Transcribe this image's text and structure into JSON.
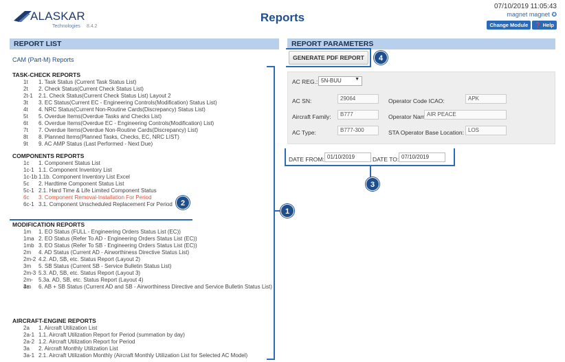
{
  "header": {
    "brand": "ALASKAR",
    "brand_sub": "Technologies",
    "version": "8.4.2",
    "title": "Reports",
    "datetime": "07/10/2019 11:05:43",
    "user": "magnet magnet",
    "change_module_label": "Change Module",
    "help_label": "Help"
  },
  "left": {
    "panel_title": "REPORT LIST",
    "cam_link": "CAM (Part-M) Reports",
    "sections": [
      {
        "title": "TASK-CHECK REPORTS",
        "items": [
          {
            "code": "1t",
            "label": "1. Task Status (Current Task Status List)"
          },
          {
            "code": "2t",
            "label": "2. Check Status(Current Check Status List)"
          },
          {
            "code": "2t-1",
            "label": "2.1. Check Status(Current Check Status List) Layout 2"
          },
          {
            "code": "3t",
            "label": "3. EC Status(Current EC - Engineering Controls(Modification) Status List)"
          },
          {
            "code": "4t",
            "label": "4. NRC Status(Current Non-Routine Cards(Discrepancy) Status List)"
          },
          {
            "code": "5t",
            "label": "5. Overdue Items(Overdue Tasks and Checks List)"
          },
          {
            "code": "6t",
            "label": "6. Overdue Items(Overdue EC - Engineering Controls(Modification) List)"
          },
          {
            "code": "7t",
            "label": "7. Overdue Items(Overdue Non-Routine Cards(Discrepancy) List)"
          },
          {
            "code": "8t",
            "label": "8. Planned Items(Planned Tasks, Checks, EC, NRC LIST)"
          },
          {
            "code": "9t",
            "label": "9. AC AMP Status (Last Performed - Next Due)"
          }
        ]
      },
      {
        "title": "COMPONENTS REPORTS",
        "items": [
          {
            "code": "1c",
            "label": "1. Component Status List"
          },
          {
            "code": "1c-1",
            "label": "1.1. Component Inventory List"
          },
          {
            "code": "1c-1b",
            "label": "1.1b. Component Inventory List Excel"
          },
          {
            "code": "5c",
            "label": "2. Hardtime Component Status List"
          },
          {
            "code": "5c-1",
            "label": "2.1. Hard Time & Life Limited Component Status"
          },
          {
            "code": "6c",
            "label": "3. Component Removal-Installation For Period"
          },
          {
            "code": "6c-1",
            "label": "3.1. Component Unscheduled Replacement For Period"
          }
        ]
      },
      {
        "title": "MODIFICATION REPORTS",
        "items": [
          {
            "code": "1m",
            "label": "1. EO Status (FULL - Engineering Orders Status List (EC))"
          },
          {
            "code": "1ma",
            "label": "2. EO Status (Refer To AD - Engineering Orders Status List (EC))"
          },
          {
            "code": "1mb",
            "label": "3. EO Status (Refer To SB - Engineering Orders Status List (EC))"
          },
          {
            "code": "2m",
            "label": "4. AD Status (Current AD - Airworthiness Directive Status List)"
          },
          {
            "code": "2m-2",
            "label": "4.2. AD, SB, etc. Status Report (Layout 2)"
          },
          {
            "code": "3m",
            "label": "5. SB Status (Current SB - Service Bulletin Status List)"
          },
          {
            "code": "2m-3",
            "label": "5.3. AD, SB, etc. Status Report (Layout 3)"
          },
          {
            "code": "2m-3a",
            "label": "5.3a. AD, SB, etc. Status Report (Layout 4)"
          },
          {
            "code": "4m",
            "label": "6. AB + SB Status (Current AD and SB - Airworthiness Directive and Service Bulletin Status List)"
          }
        ]
      },
      {
        "title": "AIRCRAFT-ENGINE REPORTS",
        "items": [
          {
            "code": "2a",
            "label": "1. Aircraft Utilization List"
          },
          {
            "code": "2a-1",
            "label": "1.1. Aircraft Utilization Report for Period (summation by day)"
          },
          {
            "code": "2a-2",
            "label": "1.2. Aircraft Utilization Report for Period"
          },
          {
            "code": "3a",
            "label": "2. Aircraft Monthly Utilization List"
          },
          {
            "code": "3a-1",
            "label": "2.1. Aircraft Utilization Monthly (Aircraft Monthly Utilization List for Selected AC Model)"
          }
        ]
      }
    ]
  },
  "right": {
    "panel_title": "REPORT PARAMETERS",
    "generate_label": "GENERATE PDF REPORT",
    "ac_reg_label": "AC REG.:",
    "ac_reg_value": "5N-BUU",
    "ac_sn_label": "AC SN:",
    "ac_sn_value": "29064",
    "operator_icao_label": "Operator Code ICAO:",
    "operator_icao_value": "APK",
    "aircraft_family_label": "Aircraft Family:",
    "aircraft_family_value": "B777",
    "operator_name_label": "Operator Name:",
    "operator_name_value": "AIR PEACE",
    "ac_type_label": "AC Type:",
    "ac_type_value": "B777-300",
    "base_location_label": "STA Operator Base Location:",
    "base_location_value": "LOS",
    "date_from_label": "DATE FROM:",
    "date_from_value": "01/10/2019",
    "date_to_label": "DATE TO:",
    "date_to_value": "07/10/2019"
  },
  "badges": {
    "b1": "1",
    "b2": "2",
    "b3": "3",
    "b4": "4"
  }
}
